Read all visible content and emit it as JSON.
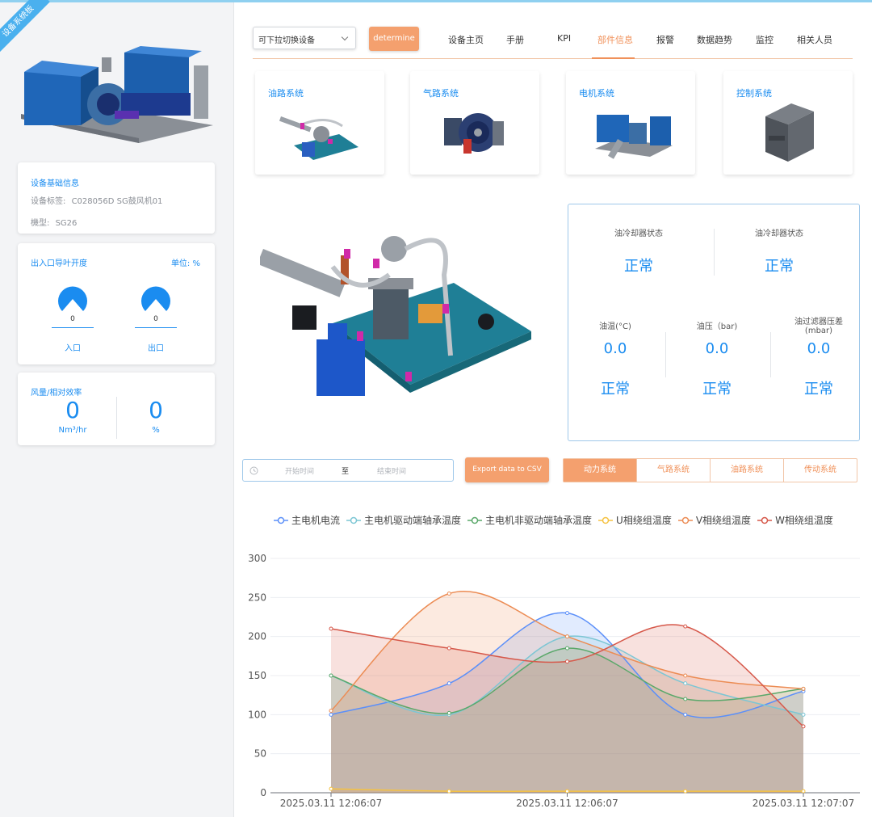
{
  "ribbon": "设备系统板",
  "left": {
    "info": {
      "title": "设备基础信息",
      "tag_label": "设备标签:",
      "tag_value": "C028056D SG鼓风机01",
      "model_label": "機型:",
      "model_value": "SG26"
    },
    "vane": {
      "title": "出入口导叶开度",
      "unit": "单位: %",
      "inlet_value": "0",
      "inlet_label": "入口",
      "outlet_value": "0",
      "outlet_label": "出口"
    },
    "flow": {
      "title": "风量/相对效率",
      "flow_value": "0",
      "flow_unit": "Nm³/hr",
      "eff_value": "0",
      "eff_unit": "%"
    }
  },
  "toolbar": {
    "select_value": "可下拉切换设备",
    "determine_label": "determine"
  },
  "nav": [
    "设备主页",
    "手册",
    "KPI",
    "部件信息",
    "报警",
    "数据趋势",
    "监控",
    "相关人员"
  ],
  "nav_active": "部件信息",
  "systems": [
    "油路系统",
    "气路系统",
    "电机系统",
    "控制系统"
  ],
  "status": {
    "cooler1_label": "油冷却器状态",
    "cooler1_value": "正常",
    "cooler2_label": "油冷却器状态",
    "cooler2_value": "正常",
    "oiltemp_label": "油温(°C)",
    "oiltemp_value": "0.0",
    "oiltemp_state": "正常",
    "oilpress_label": "油压（bar)",
    "oilpress_value": "0.0",
    "oilpress_state": "正常",
    "filter_label": "油过滤器压差",
    "filter_unit": "(mbar)",
    "filter_value": "0.0",
    "filter_state": "正常"
  },
  "filters": {
    "start_placeholder": "开始时间",
    "to": "至",
    "end_placeholder": "结束时间",
    "export_label": "Export data to CSV",
    "tabs": [
      "动力系统",
      "气路系统",
      "油路系统",
      "传动系统"
    ],
    "active_tab": "动力系统"
  },
  "chart_data": {
    "type": "area",
    "x": [
      "2025.03.11 12:06:07",
      "",
      "2025.03.11 12:06:07",
      "",
      "2025.03.11 12:07:07"
    ],
    "x_tick_labels": [
      "2025.03.11 12:06:07",
      "2025.03.11 12:06:07",
      "2025.03.11 12:07:07"
    ],
    "ylim": [
      0,
      300
    ],
    "yticks": [
      0,
      50,
      100,
      150,
      200,
      250,
      300
    ],
    "grid": true,
    "legend_position": "top",
    "smooth": true,
    "series": [
      {
        "name": "主电机电流",
        "color": "#5b8ff9",
        "values": [
          100,
          140,
          230,
          100,
          130
        ]
      },
      {
        "name": "主电机驱动端轴承温度",
        "color": "#7cc6d4",
        "values": [
          150,
          100,
          200,
          140,
          100
        ]
      },
      {
        "name": "主电机非驱动端轴承温度",
        "color": "#5aa86a",
        "values": [
          150,
          102,
          185,
          120,
          133
        ]
      },
      {
        "name": "U相绕组温度",
        "color": "#f5c242",
        "values": [
          5,
          2,
          2,
          2,
          2
        ]
      },
      {
        "name": "V相绕组温度",
        "color": "#ec8c54",
        "values": [
          105,
          255,
          200,
          150,
          133
        ]
      },
      {
        "name": "W相绕组温度",
        "color": "#d6584a",
        "values": [
          210,
          185,
          168,
          213,
          85
        ]
      }
    ]
  }
}
